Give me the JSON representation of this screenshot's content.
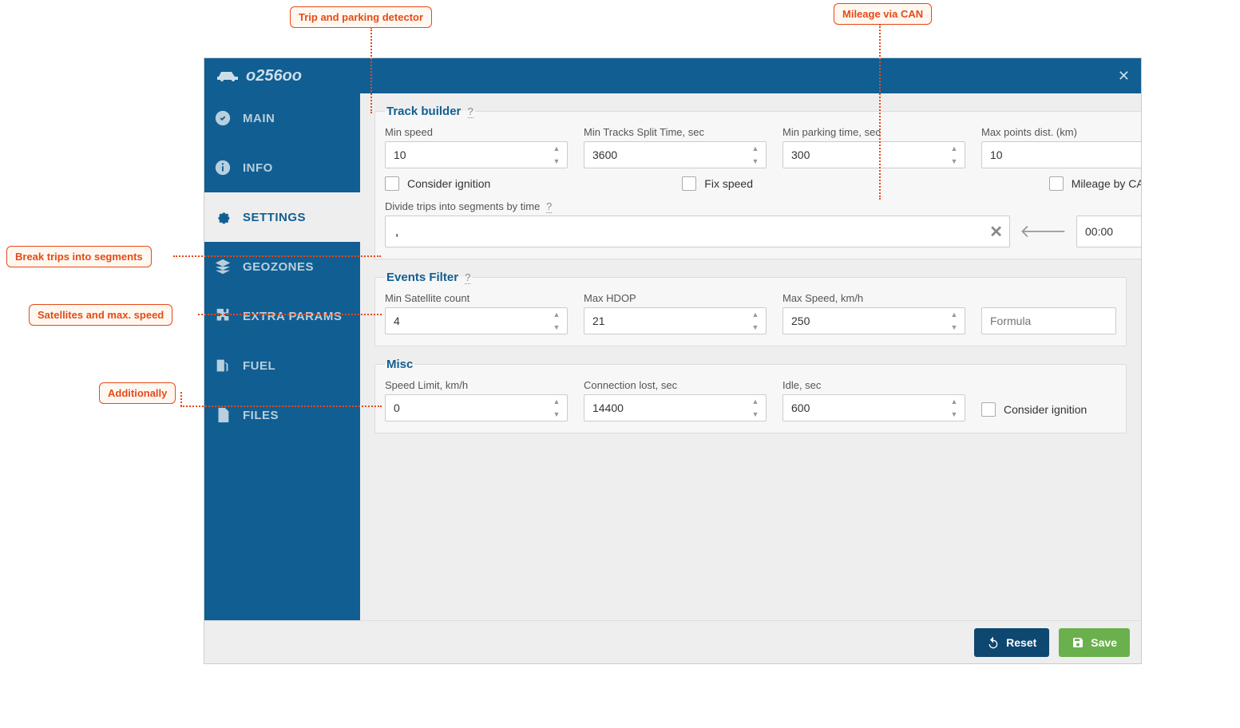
{
  "callouts": {
    "trip_parking": "Trip and parking detector",
    "mileage_can": "Mileage via CAN",
    "break_segments": "Break trips into segments",
    "satellites": "Satellites and max. speed",
    "additionally": "Additionally"
  },
  "header": {
    "title": "о256оо"
  },
  "sidebar": {
    "main": "MAIN",
    "info": "INFO",
    "settings": "SETTINGS",
    "geozones": "GEOZONES",
    "extra": "EXTRA PARAMS",
    "fuel": "FUEL",
    "files": "FILES"
  },
  "track_builder": {
    "legend": "Track builder",
    "min_speed_label": "Min speed",
    "min_speed": "10",
    "split_time_label": "Min Tracks Split Time, sec",
    "split_time": "3600",
    "min_parking_label": "Min parking time, sec",
    "min_parking": "300",
    "max_points_label": "Max points dist. (km)",
    "max_points": "10",
    "consider_ignition": "Consider ignition",
    "fix_speed": "Fix speed",
    "mileage_can": "Mileage by CAN",
    "divide_label": "Divide trips into segments by time",
    "divide_value": ",",
    "time_value": "00:00"
  },
  "events_filter": {
    "legend": "Events Filter",
    "min_sat_label": "Min Satellite count",
    "min_sat": "4",
    "max_hdop_label": "Max HDOP",
    "max_hdop": "21",
    "max_speed_label": "Max Speed, km/h",
    "max_speed": "250",
    "formula_placeholder": "Formula"
  },
  "misc": {
    "legend": "Misc",
    "speed_limit_label": "Speed Limit, km/h",
    "speed_limit": "0",
    "conn_lost_label": "Connection lost, sec",
    "conn_lost": "14400",
    "idle_label": "Idle, sec",
    "idle": "600",
    "consider_ignition": "Consider ignition"
  },
  "footer": {
    "reset": "Reset",
    "save": "Save"
  }
}
